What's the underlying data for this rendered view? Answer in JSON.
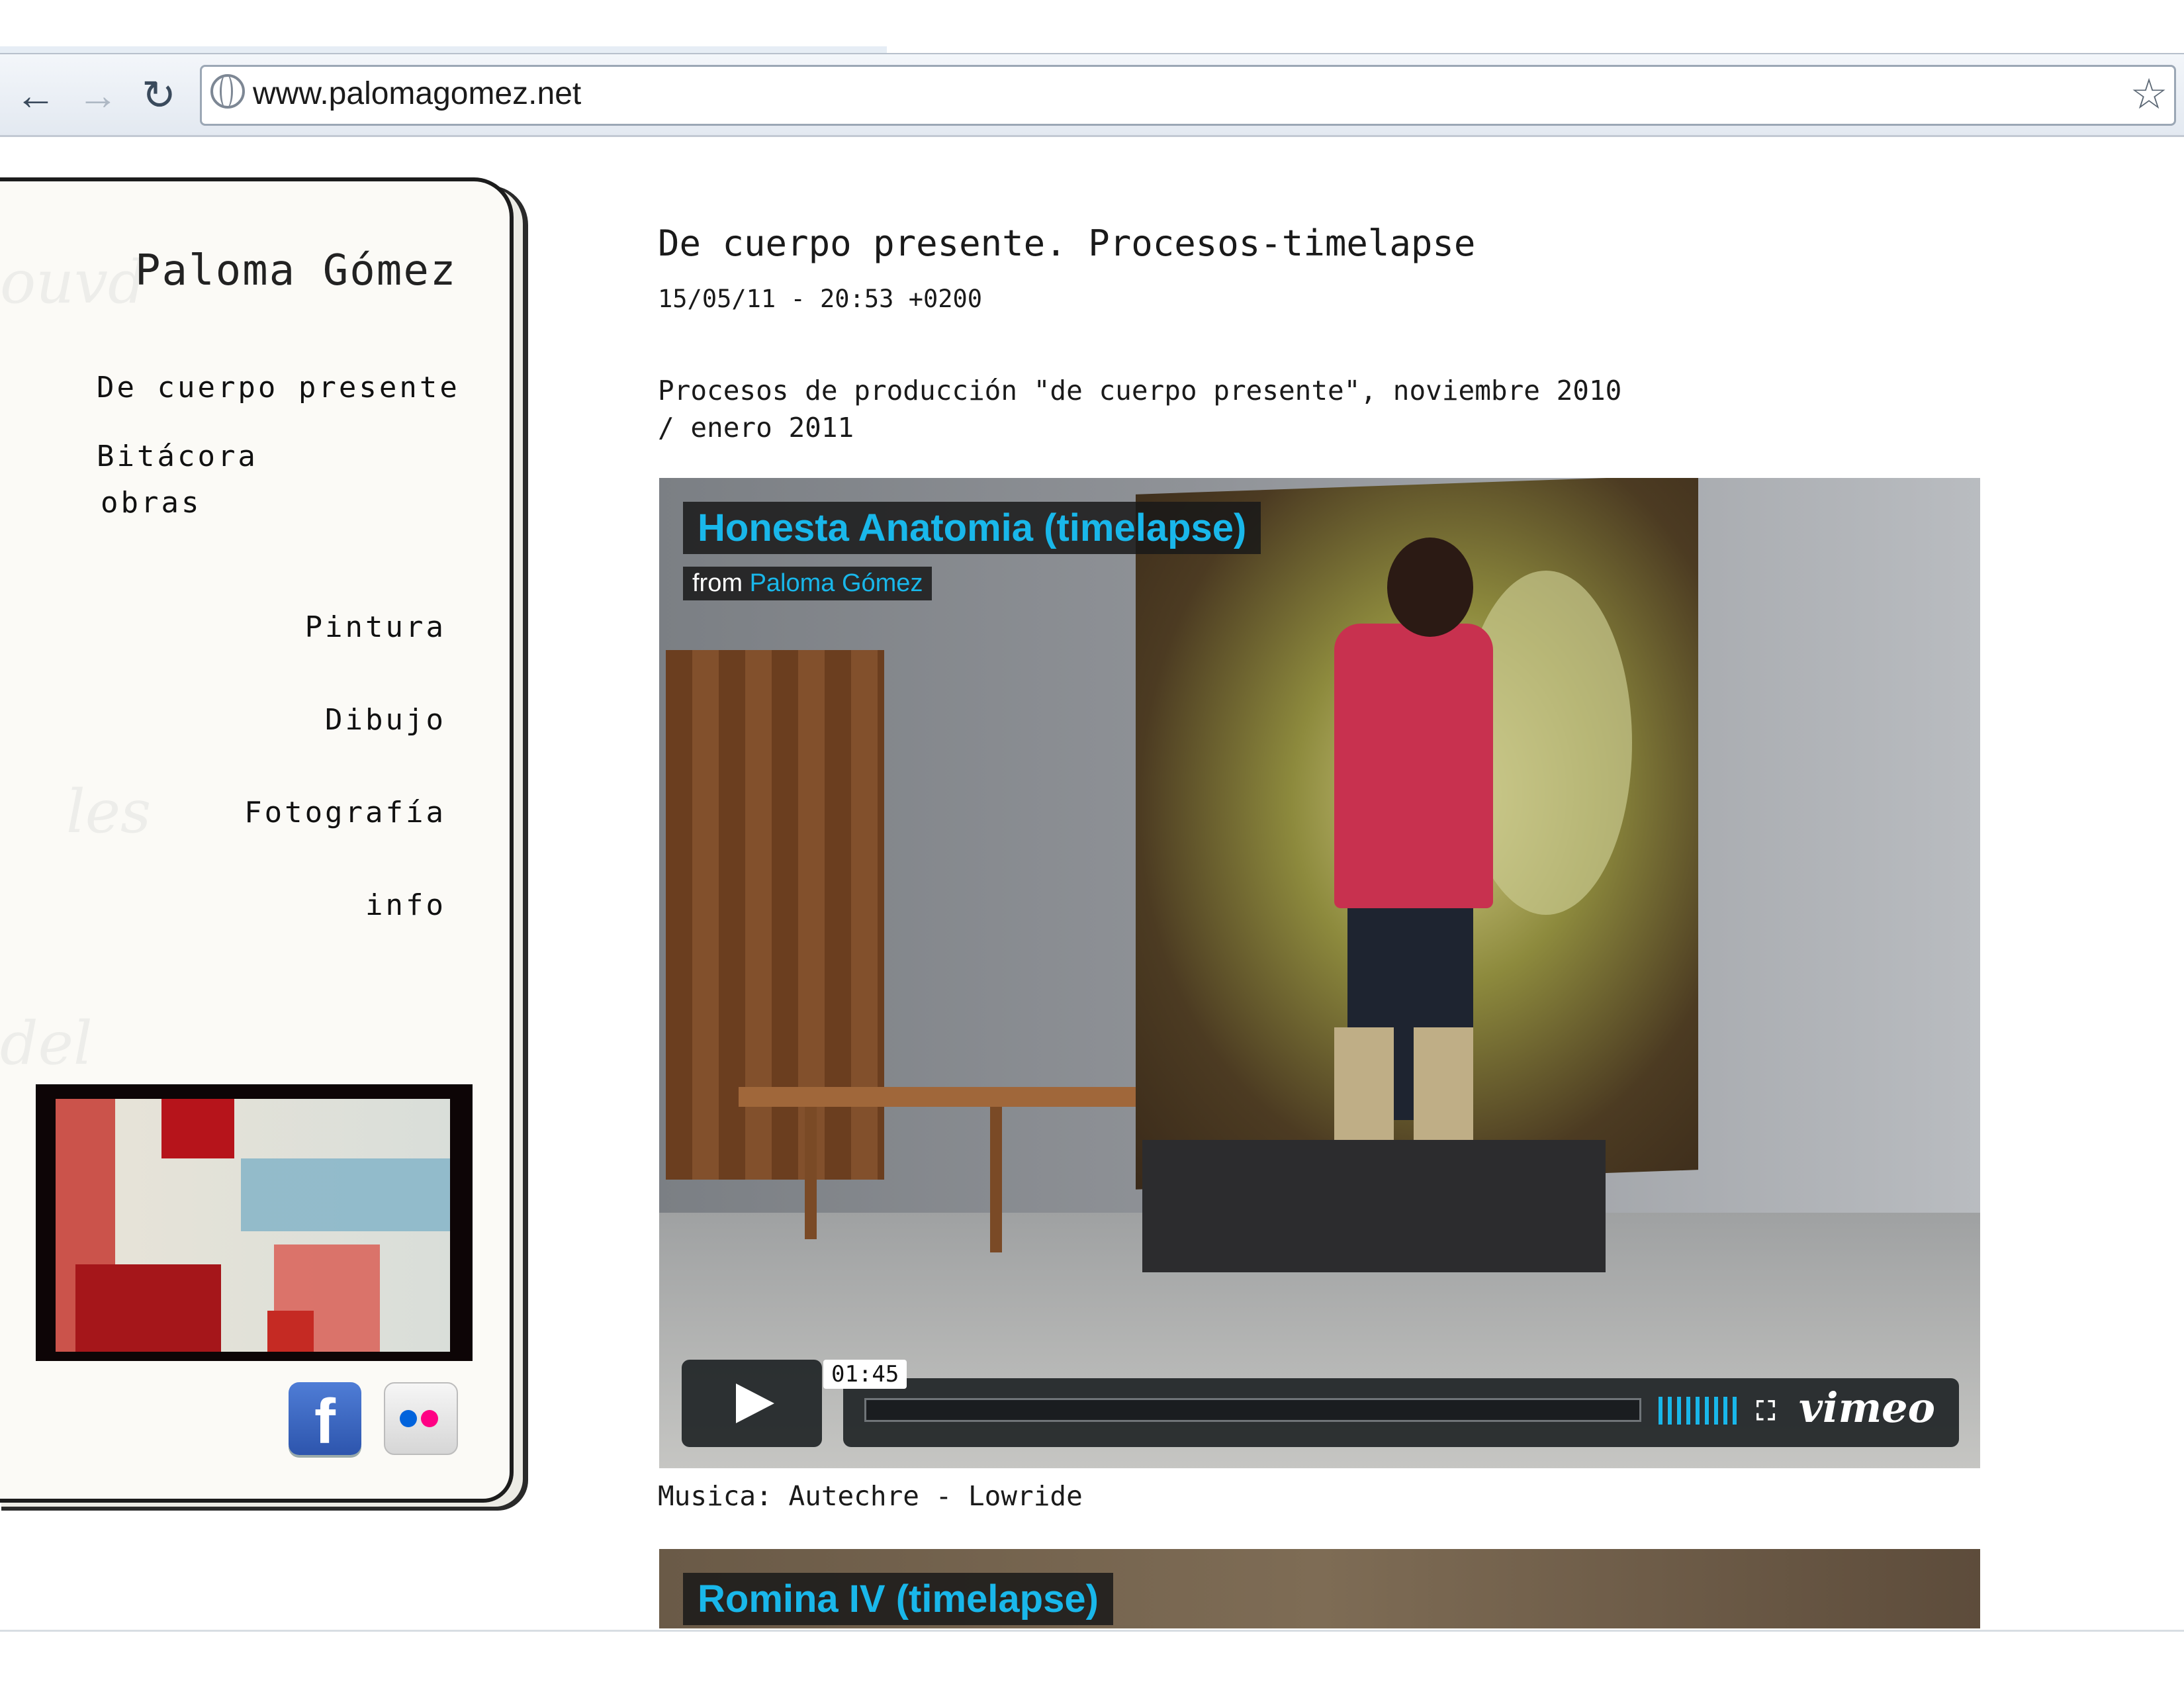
{
  "browser": {
    "url": "www.palomagomez.net",
    "back_icon": "←",
    "forward_icon": "→",
    "reload_icon": "↻",
    "bookmark_icon": "☆"
  },
  "sidebar": {
    "site_title": "Paloma Gómez",
    "nav": {
      "de_cuerpo_presente": "De cuerpo presente",
      "bitacora": "Bitácora",
      "obras": "obras",
      "pintura": "Pintura",
      "dibujo": "Dibujo",
      "fotografia": "Fotografía",
      "info": "info"
    },
    "social": {
      "facebook_glyph": "f"
    }
  },
  "post": {
    "title": "De cuerpo presente. Procesos-timelapse",
    "date": "15/05/11 - 20:53 +0200",
    "body": "Procesos de producción \"de cuerpo presente\", noviembre 2010\n/ enero 2011",
    "video1": {
      "title": "Honesta Anatomia (timelapse)",
      "from_label": "from",
      "author": "Paloma Gómez",
      "timecode": "01:45",
      "brand": "vimeo",
      "fullscreen_glyph": "⛶"
    },
    "music": "Musica: Autechre - Lowride",
    "video2": {
      "title": "Romina IV (timelapse)"
    }
  },
  "colors": {
    "vimeo_accent": "#19b7ea",
    "facebook_blue": "#3b5998",
    "flickr_blue": "#0063dc",
    "flickr_pink": "#ff0084"
  }
}
